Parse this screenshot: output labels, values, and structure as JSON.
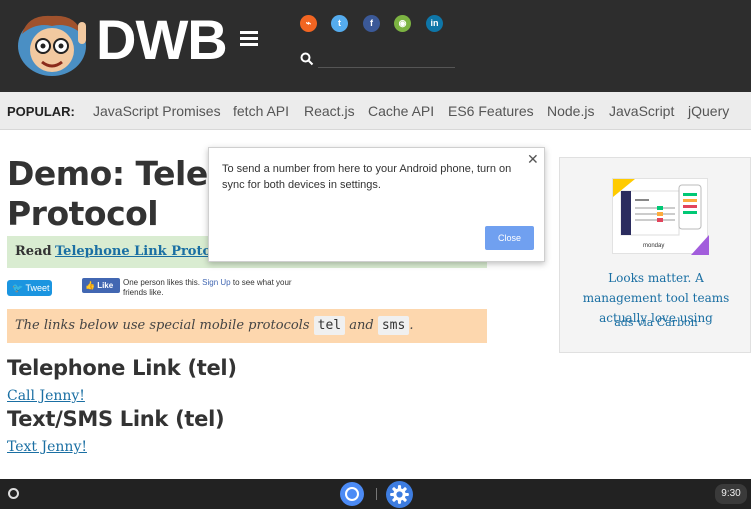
{
  "header": {
    "brand": "DWB",
    "search_placeholder": "",
    "social": [
      {
        "name": "rss",
        "color": "#f26522",
        "glyph": "⌁"
      },
      {
        "name": "twitter",
        "color": "#55acee",
        "glyph": "t"
      },
      {
        "name": "facebook",
        "color": "#3b5998",
        "glyph": "f"
      },
      {
        "name": "github",
        "color": "#7cb342",
        "glyph": "◉"
      },
      {
        "name": "linkedin",
        "color": "#0e76a8",
        "glyph": "in"
      }
    ]
  },
  "popular": {
    "label": "POPULAR:",
    "links": [
      "JavaScript Promises",
      "fetch API",
      "React.js",
      "Cache API",
      "ES6 Features",
      "Node.js",
      "JavaScript",
      "jQuery"
    ]
  },
  "article": {
    "title_line1": "Demo: Telep",
    "title_line2": "Protocol",
    "read_label": "Read",
    "read_link": "Telephone Link Proto",
    "tweet_label": "Tweet",
    "like_label": "Like",
    "like_text": "One person likes this.",
    "like_signup": "Sign Up",
    "like_text_end": "to see what your friends like.",
    "proto_text_before": "The links below use special mobile protocols",
    "proto_code1": "tel",
    "proto_and": "and",
    "proto_code2": "sms",
    "proto_end": ".",
    "h2_tel": "Telephone Link (tel)",
    "link_call": "Call Jenny!",
    "h2_sms": "Text/SMS Link (tel)",
    "link_text": "Text Jenny!"
  },
  "ad": {
    "text": "Looks matter. A management tool teams actually love using",
    "via": "ads via Carbon",
    "brand": "monday"
  },
  "popup": {
    "message": "To send a number from here to your Android phone, turn on sync for both devices in settings.",
    "close_label": "Close",
    "close_x": "✕"
  },
  "taskbar": {
    "time": "9:30"
  },
  "colors": {
    "header_bg": "#2d2d2d",
    "link": "#1a6fa3",
    "read_box": "#d9ecd1",
    "proto_box": "#fdd7ae",
    "popup_button": "#70a0f0"
  }
}
